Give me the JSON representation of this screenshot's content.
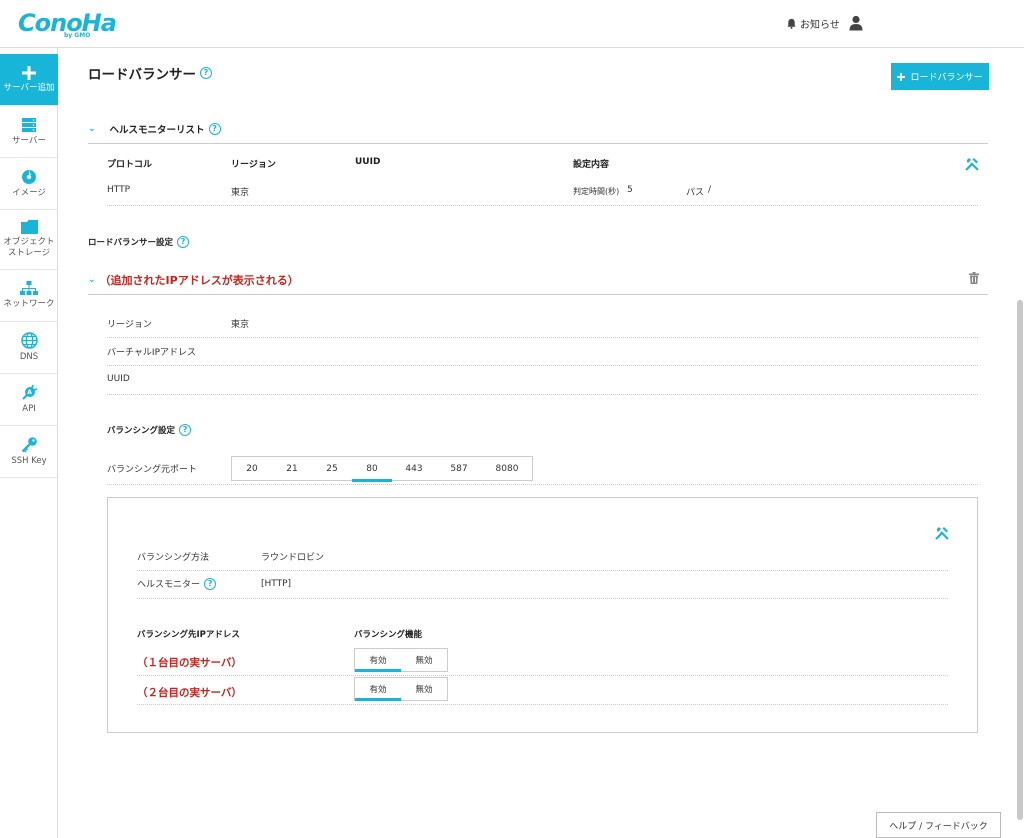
{
  "header": {
    "logo": "ConoHa",
    "logo_sub": "by GMO",
    "notice_label": "お知らせ"
  },
  "sidebar": {
    "items": [
      {
        "label": "サーバー追加",
        "icon": "plus-icon"
      },
      {
        "label": "サーバー",
        "icon": "server-icon"
      },
      {
        "label": "イメージ",
        "icon": "image-icon"
      },
      {
        "label": "オブジェクト\nストレージ",
        "icon": "folder-icon"
      },
      {
        "label": "ネットワーク",
        "icon": "network-icon"
      },
      {
        "label": "DNS",
        "icon": "globe-icon"
      },
      {
        "label": "API",
        "icon": "api-icon"
      },
      {
        "label": "SSH Key",
        "icon": "key-icon"
      }
    ]
  },
  "page": {
    "title": "ロードバランサー",
    "add_button": "ロードバランサー"
  },
  "health_monitor": {
    "heading": "ヘルスモニターリスト",
    "columns": [
      "プロトコル",
      "リージョン",
      "UUID",
      "設定内容"
    ],
    "row": {
      "protocol": "HTTP",
      "region": "東京",
      "uuid": "",
      "interval_label": "判定時間(秒)",
      "interval_value": "5",
      "path_label": "パス",
      "path_value": "/"
    }
  },
  "lb_settings": {
    "heading": "ロードバランサー設定",
    "ip_note": "（追加されたIPアドレスが表示される）",
    "fields": [
      {
        "label": "リージョン",
        "value": "東京"
      },
      {
        "label": "バーチャルIPアドレス",
        "value": ""
      },
      {
        "label": "UUID",
        "value": ""
      }
    ]
  },
  "balancing": {
    "heading": "バランシング設定",
    "port_label": "バランシング元ポート",
    "ports": [
      "20",
      "21",
      "25",
      "80",
      "443",
      "587",
      "8080"
    ],
    "active_port": "80",
    "method_label": "バランシング方法",
    "method_value": "ラウンドロビン",
    "monitor_label": "ヘルスモニター",
    "monitor_value": "[HTTP]",
    "dest_header": "バランシング先IPアドレス",
    "func_header": "バランシング機能",
    "servers": [
      {
        "label": "（１台目の実サーバ）",
        "on": "有効",
        "off": "無効"
      },
      {
        "label": "（２台目の実サーバ）",
        "on": "有効",
        "off": "無効"
      }
    ]
  },
  "footer": {
    "help_feedback": "ヘルプ / フィードバック"
  },
  "colors": {
    "accent": "#19b5d8",
    "note_red": "#c8231e"
  }
}
